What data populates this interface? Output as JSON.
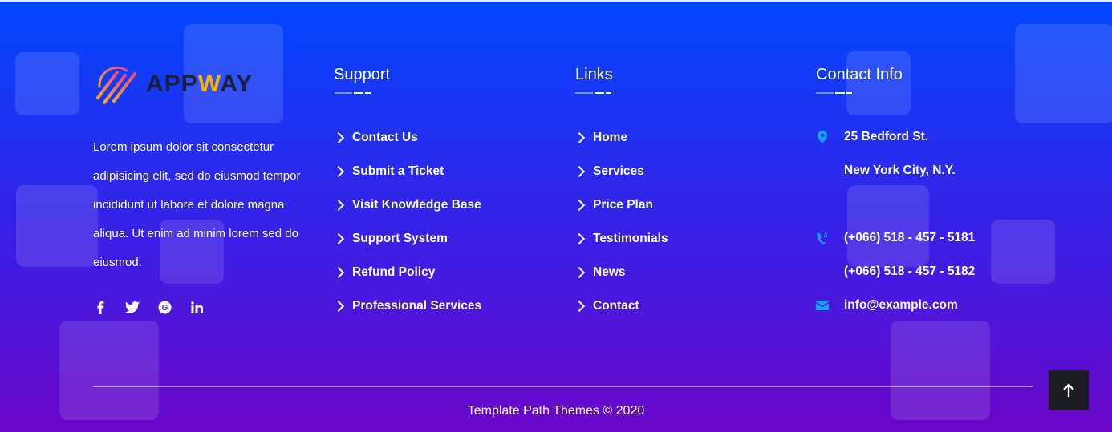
{
  "brand": {
    "name_part1": "APP",
    "name_accent": "W",
    "name_part2": "AY",
    "accent_color": "#f5b400"
  },
  "about": {
    "text": "Lorem ipsum dolor sit consectetur adipisicing elit, sed do eiusmod tempor incididunt ut labore et dolore magna aliqua. Ut enim ad minim lorem sed do eiusmod."
  },
  "social": [
    "facebook-icon",
    "twitter-icon",
    "google-plus-icon",
    "linkedin-icon"
  ],
  "support": {
    "title": "Support",
    "items": [
      "Contact Us",
      "Submit a Ticket",
      "Visit Knowledge Base",
      "Support System",
      "Refund Policy",
      "Professional Services"
    ]
  },
  "links": {
    "title": "Links",
    "items": [
      "Home",
      "Services",
      "Price Plan",
      "Testimonials",
      "News",
      "Contact"
    ]
  },
  "contact": {
    "title": "Contact Info",
    "address_line1": "25 Bedford St.",
    "address_line2": "New York City, N.Y.",
    "phone1": "(+066) 518 - 457 - 5181",
    "phone2": "(+066) 518 - 457 - 5182",
    "email": "info@example.com"
  },
  "footer": {
    "copyright": "Template Path Themes © 2020"
  },
  "colors": {
    "gradient_top": "#0047ff",
    "gradient_bottom": "#6a06c8",
    "icon_blue": "#0fa2ff",
    "back_to_top_bg": "#1c1d22"
  }
}
